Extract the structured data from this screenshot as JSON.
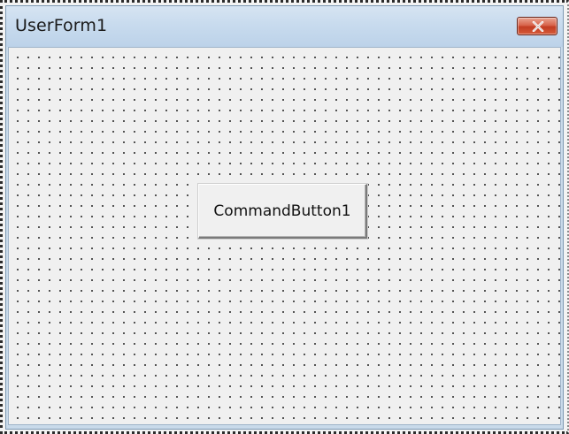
{
  "window": {
    "title": "UserForm1",
    "close_icon": "close-icon",
    "accent_color": "#c9daea",
    "close_color": "#c23c22"
  },
  "form": {
    "grid": "dotted design grid",
    "command_button_label": "CommandButton1"
  }
}
